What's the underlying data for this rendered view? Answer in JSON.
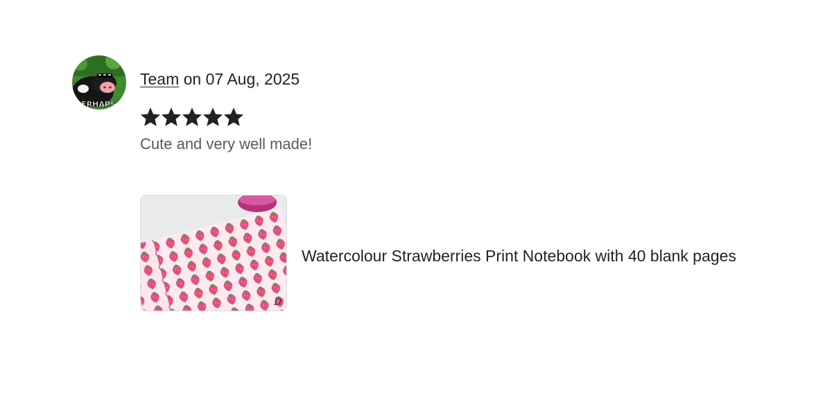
{
  "review": {
    "author": "Team",
    "date_prefix": " on ",
    "date": "07 Aug, 2025",
    "rating": 5,
    "rating_max": 5,
    "text": "Cute and very well made!",
    "avatar": {
      "icon": "cow-meme-avatar-icon",
      "caption": "PERHAPS"
    }
  },
  "product": {
    "title": "Watercolour Strawberries Print Notebook with 40 blank pages",
    "image": "strawberry-notebook-thumbnail"
  },
  "colors": {
    "text_primary": "#222222",
    "text_secondary": "#595959",
    "star": "#222222",
    "strawberry": "#e0507a"
  }
}
